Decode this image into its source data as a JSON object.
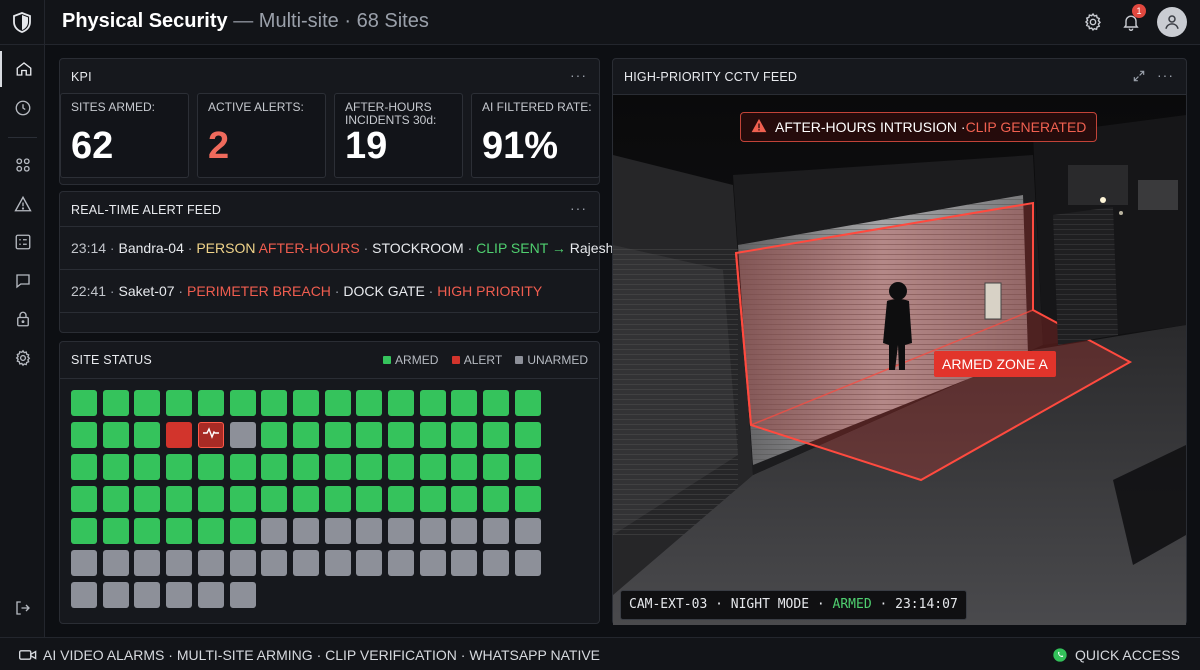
{
  "header": {
    "title": "Physical Security",
    "separator": "—",
    "subtitle": "Multi-site · 68 Sites",
    "notification_count": "1",
    "icons": [
      "shield-logo-icon",
      "gear-icon",
      "bell-icon",
      "user-icon"
    ]
  },
  "sidebar": {
    "items": [
      {
        "name": "home",
        "icon": "home-icon",
        "active": true
      },
      {
        "name": "history",
        "icon": "clock-icon",
        "active": false
      },
      {
        "name": "dashboard",
        "icon": "grid-icon",
        "active": false
      },
      {
        "name": "alerts",
        "icon": "warning-icon",
        "active": false
      },
      {
        "name": "reports",
        "icon": "checklist-icon",
        "active": false
      },
      {
        "name": "messages",
        "icon": "chat-icon",
        "active": false
      },
      {
        "name": "locks",
        "icon": "lock-icon",
        "active": false
      },
      {
        "name": "settings",
        "icon": "gear-icon",
        "active": false
      }
    ],
    "footer_icon": "logout-icon"
  },
  "kpi": {
    "title": "KPI",
    "menu": "···",
    "cards": [
      {
        "label": "SITES ARMED:",
        "value": "62"
      },
      {
        "label": "ACTIVE ALERTS:",
        "value": "2"
      },
      {
        "label": "AFTER-HOURS INCIDENTS 30d:",
        "value": "19"
      },
      {
        "label": "AI FILTERED RATE:",
        "value": "91%"
      }
    ]
  },
  "alert_feed": {
    "title": "REAL-TIME ALERT FEED",
    "menu": "···",
    "rows": [
      {
        "time": "23:14",
        "sep1": " · ",
        "site": "Bandra-04",
        "sep2": " · ",
        "subject": "PERSON ",
        "event": "AFTER-HOURS",
        "sep3": " · ",
        "zone": "STOCKROOM",
        "sep4": " · ",
        "action": "CLIP SENT → ",
        "assignee": "Rajesh S."
      },
      {
        "time": "22:41",
        "sep1": " · ",
        "site": "Saket-07",
        "sep2": " · ",
        "event": "PERIMETER BREACH",
        "sep3": " · ",
        "zone": "DOCK GATE",
        "sep4": " · ",
        "priority": "HIGH PRIORITY"
      }
    ]
  },
  "site_status": {
    "title": "SITE STATUS",
    "legend": {
      "armed": "ARMED",
      "alert": "ALERT",
      "unarmed": "UNARMED"
    },
    "colors": {
      "armed": "#35c35c",
      "alert": "#d2342c",
      "unarmed": "#8d9099"
    },
    "rows": [
      [
        "armed",
        "armed",
        "armed",
        "armed",
        "armed",
        "armed",
        "armed",
        "armed",
        "armed",
        "armed",
        "armed",
        "armed",
        "armed",
        "armed",
        "armed"
      ],
      [
        "armed",
        "armed",
        "armed",
        "alert",
        "alert-marked",
        "unarmed",
        "armed",
        "armed",
        "armed",
        "armed",
        "armed",
        "armed",
        "armed",
        "armed",
        "armed"
      ],
      [
        "armed",
        "armed",
        "armed",
        "armed",
        "armed",
        "armed",
        "armed",
        "armed",
        "armed",
        "armed",
        "armed",
        "armed",
        "armed",
        "armed",
        "armed"
      ],
      [
        "armed",
        "armed",
        "armed",
        "armed",
        "armed",
        "armed",
        "armed",
        "armed",
        "armed",
        "armed",
        "armed",
        "armed",
        "armed",
        "armed",
        "armed"
      ],
      [
        "armed",
        "armed",
        "armed",
        "armed",
        "armed",
        "armed",
        "unarmed",
        "unarmed",
        "unarmed",
        "unarmed",
        "unarmed",
        "unarmed",
        "unarmed",
        "unarmed",
        "unarmed"
      ],
      [
        "unarmed",
        "unarmed",
        "unarmed",
        "unarmed",
        "unarmed",
        "unarmed",
        "unarmed",
        "unarmed",
        "unarmed",
        "unarmed",
        "unarmed",
        "unarmed",
        "unarmed",
        "unarmed",
        "unarmed"
      ],
      [
        "unarmed",
        "unarmed",
        "unarmed",
        "unarmed",
        "unarmed",
        "unarmed"
      ]
    ]
  },
  "cctv": {
    "title": "HIGH-PRIORITY CCTV FEED",
    "menu": "···",
    "alert_banner": {
      "text": "AFTER-HOURS INTRUSION · ",
      "highlight": "CLIP GENERATED"
    },
    "zone_label": "ARMED ZONE A",
    "camera": {
      "id": "CAM-EXT-03",
      "sep1": " · ",
      "mode": "NIGHT MODE",
      "sep2": " · ",
      "status": "ARMED",
      "sep3": " · ",
      "time": "23:14:07"
    }
  },
  "footer": {
    "features": [
      "AI VIDEO ALARMS",
      "MULTI-SITE ARMING",
      "CLIP VERIFICATION",
      "WHATSAPP NATIVE"
    ],
    "separator": " · ",
    "quick_access": "QUICK ACCESS"
  }
}
